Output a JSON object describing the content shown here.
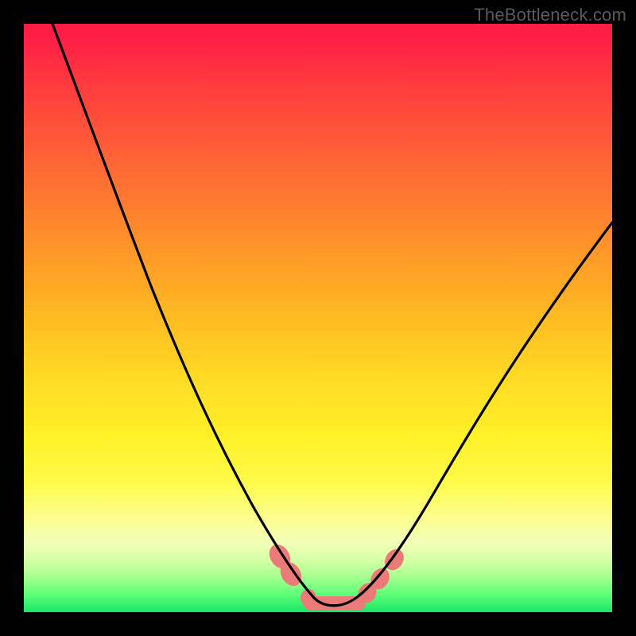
{
  "watermark": "TheBottleneck.com",
  "colors": {
    "frame": "#000000",
    "curve": "#000000",
    "blob": "#eb7b78",
    "gradient_stops": [
      "#ff1a48",
      "#ff3a3f",
      "#ff7a30",
      "#ffbb22",
      "#fff028",
      "#fcfd8e",
      "#a6ff90",
      "#19e566"
    ]
  },
  "chart_data": {
    "type": "line",
    "title": "",
    "xlabel": "",
    "ylabel": "",
    "xlim": [
      0,
      100
    ],
    "ylim": [
      0,
      100
    ],
    "note": "Stylized V-shaped bottleneck curve over a rainbow heat background. Black frame. Salmon blobs highlight points near the trough.",
    "series": [
      {
        "name": "left-arm",
        "x": [
          5,
          10,
          15,
          20,
          25,
          30,
          35,
          40,
          43,
          46,
          48.5
        ],
        "y": [
          100,
          86,
          72,
          58,
          45,
          33,
          23,
          14,
          9,
          5,
          2.5
        ]
      },
      {
        "name": "trough",
        "x": [
          48.5,
          50,
          52,
          54,
          56,
          58
        ],
        "y": [
          2.5,
          1.3,
          1.0,
          1.0,
          1.3,
          2.5
        ]
      },
      {
        "name": "right-arm",
        "x": [
          58,
          62,
          68,
          75,
          82,
          90,
          100
        ],
        "y": [
          2.5,
          6,
          13,
          24,
          36,
          49,
          66
        ]
      }
    ],
    "highlight_points": [
      {
        "x": 43.5,
        "y": 9.5
      },
      {
        "x": 45.5,
        "y": 6.5
      },
      {
        "x": 48.5,
        "y": 2.8
      },
      {
        "x": 53.0,
        "y": 1.0
      },
      {
        "x": 57.5,
        "y": 2.8
      },
      {
        "x": 60.0,
        "y": 5.0
      },
      {
        "x": 62.5,
        "y": 8.0
      }
    ]
  }
}
